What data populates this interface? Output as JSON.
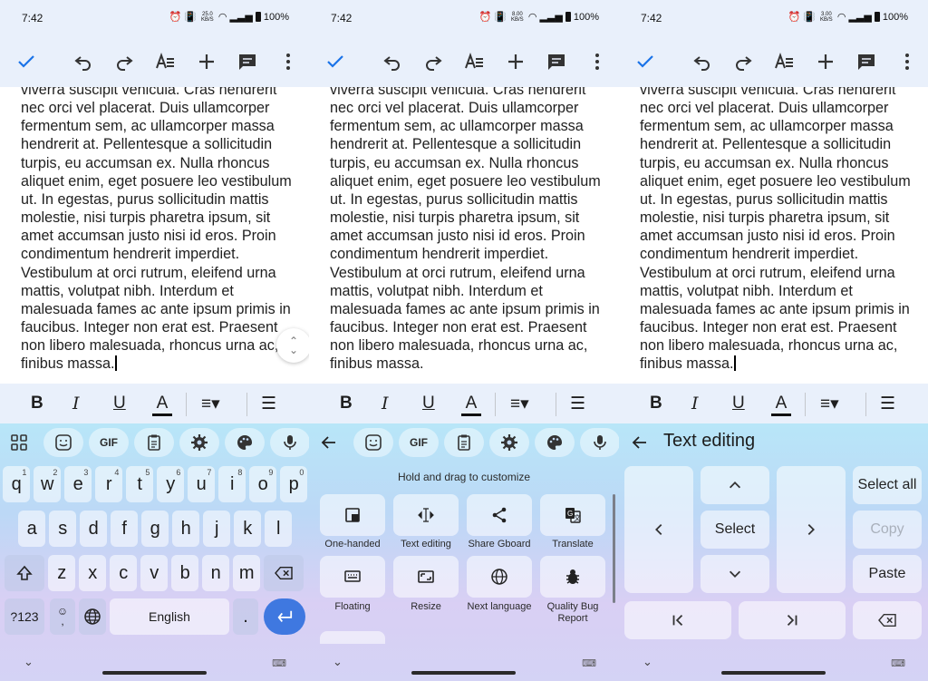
{
  "status_bar": {
    "time": "7:42",
    "battery": "100%",
    "net_speeds": [
      "25.0",
      "8.00",
      "3.00"
    ],
    "net_unit": "KB/S"
  },
  "document": {
    "text": "viverra suscipit vehicula. Cras hendrerit nec orci vel placerat. Duis ullamcorper fermentum sem, ac ullamcorper massa hendrerit at. Pellentesque a sollicitudin turpis, eu accumsan ex. Nulla rhoncus aliquet enim, eget posuere leo vestibulum ut. In egestas, purus sollicitudin mattis molestie, nisi turpis pharetra ipsum, sit amet accumsan justo nisi id eros. Proin condimentum hendrerit imperdiet. Vestibulum at orci rutrum, eleifend urna mattis, volutpat nibh. Interdum et malesuada fames ac ante ipsum primis in faucibus. Integer non erat est. Praesent non libero malesuada, rhoncus urna ac, finibus massa."
  },
  "format_bar": {
    "bold": "B",
    "italic": "I",
    "underline": "U",
    "text_color": "A"
  },
  "keyboard": {
    "toolbar_gif": "GIF",
    "rows": [
      [
        {
          "k": "q",
          "s": "1"
        },
        {
          "k": "w",
          "s": "2"
        },
        {
          "k": "e",
          "s": "3"
        },
        {
          "k": "r",
          "s": "4"
        },
        {
          "k": "t",
          "s": "5"
        },
        {
          "k": "y",
          "s": "6"
        },
        {
          "k": "u",
          "s": "7"
        },
        {
          "k": "i",
          "s": "8"
        },
        {
          "k": "o",
          "s": "9"
        },
        {
          "k": "p",
          "s": "0"
        }
      ],
      [
        {
          "k": "a"
        },
        {
          "k": "s"
        },
        {
          "k": "d"
        },
        {
          "k": "f"
        },
        {
          "k": "g"
        },
        {
          "k": "h"
        },
        {
          "k": "j"
        },
        {
          "k": "k"
        },
        {
          "k": "l"
        }
      ],
      [
        {
          "k": "z"
        },
        {
          "k": "x"
        },
        {
          "k": "c"
        },
        {
          "k": "v"
        },
        {
          "k": "b"
        },
        {
          "k": "n"
        },
        {
          "k": "m"
        }
      ]
    ],
    "symbols_key": "?123",
    "emoji_comma": ",",
    "space_label": "English",
    "period": "."
  },
  "customize_panel": {
    "hint": "Hold and drag to customize",
    "tiles": [
      {
        "label": "One-handed",
        "icon": "one-handed-icon"
      },
      {
        "label": "Text editing",
        "icon": "text-editing-icon"
      },
      {
        "label": "Share Gboard",
        "icon": "share-icon"
      },
      {
        "label": "Translate",
        "icon": "translate-icon"
      },
      {
        "label": "Floating",
        "icon": "floating-keyboard-icon"
      },
      {
        "label": "Resize",
        "icon": "resize-icon"
      },
      {
        "label": "Next language",
        "icon": "globe-icon"
      },
      {
        "label": "Quality Bug Report",
        "icon": "bug-icon"
      }
    ]
  },
  "text_editing_panel": {
    "title": "Text editing",
    "select": "Select",
    "select_all": "Select all",
    "copy": "Copy",
    "paste": "Paste"
  },
  "colors": {
    "accent": "#3f78e0",
    "toolbar_bg": "#e9f0fb"
  }
}
